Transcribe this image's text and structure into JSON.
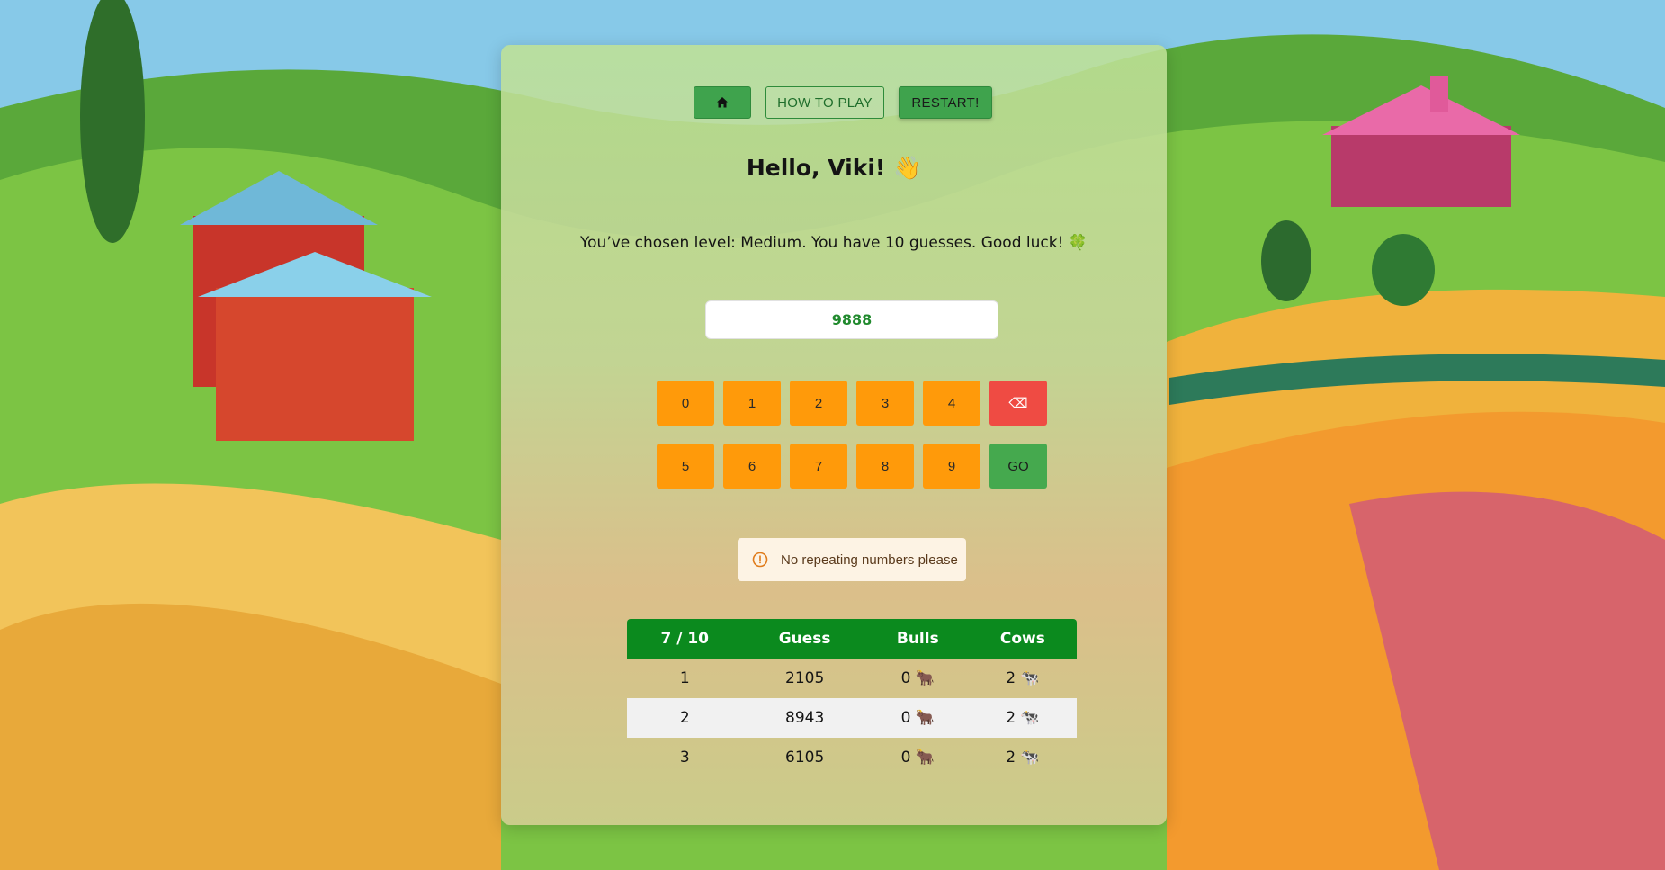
{
  "nav": {
    "home_icon": "home-icon",
    "how_to_play_label": "HOW TO PLAY",
    "restart_label": "RESTART!"
  },
  "greeting": "Hello, Viki! 👋",
  "level_message": "You’ve chosen level: Medium. You have 10 guesses. Good luck! 🍀",
  "guess_input": {
    "value": "9888"
  },
  "keypad": {
    "row1": [
      "0",
      "1",
      "2",
      "3",
      "4"
    ],
    "delete_label": "⌫",
    "row2": [
      "5",
      "6",
      "7",
      "8",
      "9"
    ],
    "go_label": "GO"
  },
  "alert": {
    "icon": "warning-circle-icon",
    "message": "No repeating numbers please"
  },
  "results": {
    "headers": [
      "7 / 10",
      "Guess",
      "Bulls",
      "Cows"
    ],
    "rows": [
      {
        "num": "1",
        "guess": "2105",
        "bulls": "0 🐂",
        "cows": "2 🐄"
      },
      {
        "num": "2",
        "guess": "8943",
        "bulls": "0 🐂",
        "cows": "2 🐄"
      },
      {
        "num": "3",
        "guess": "6105",
        "bulls": "0 🐂",
        "cows": "2 🐄"
      }
    ]
  },
  "colors": {
    "primary_green": "#3fa34d",
    "digit_orange": "#ff9a0a",
    "delete_red": "#ef4b43",
    "table_header_green": "#0b8a1e",
    "input_text_green": "#218a2e"
  }
}
